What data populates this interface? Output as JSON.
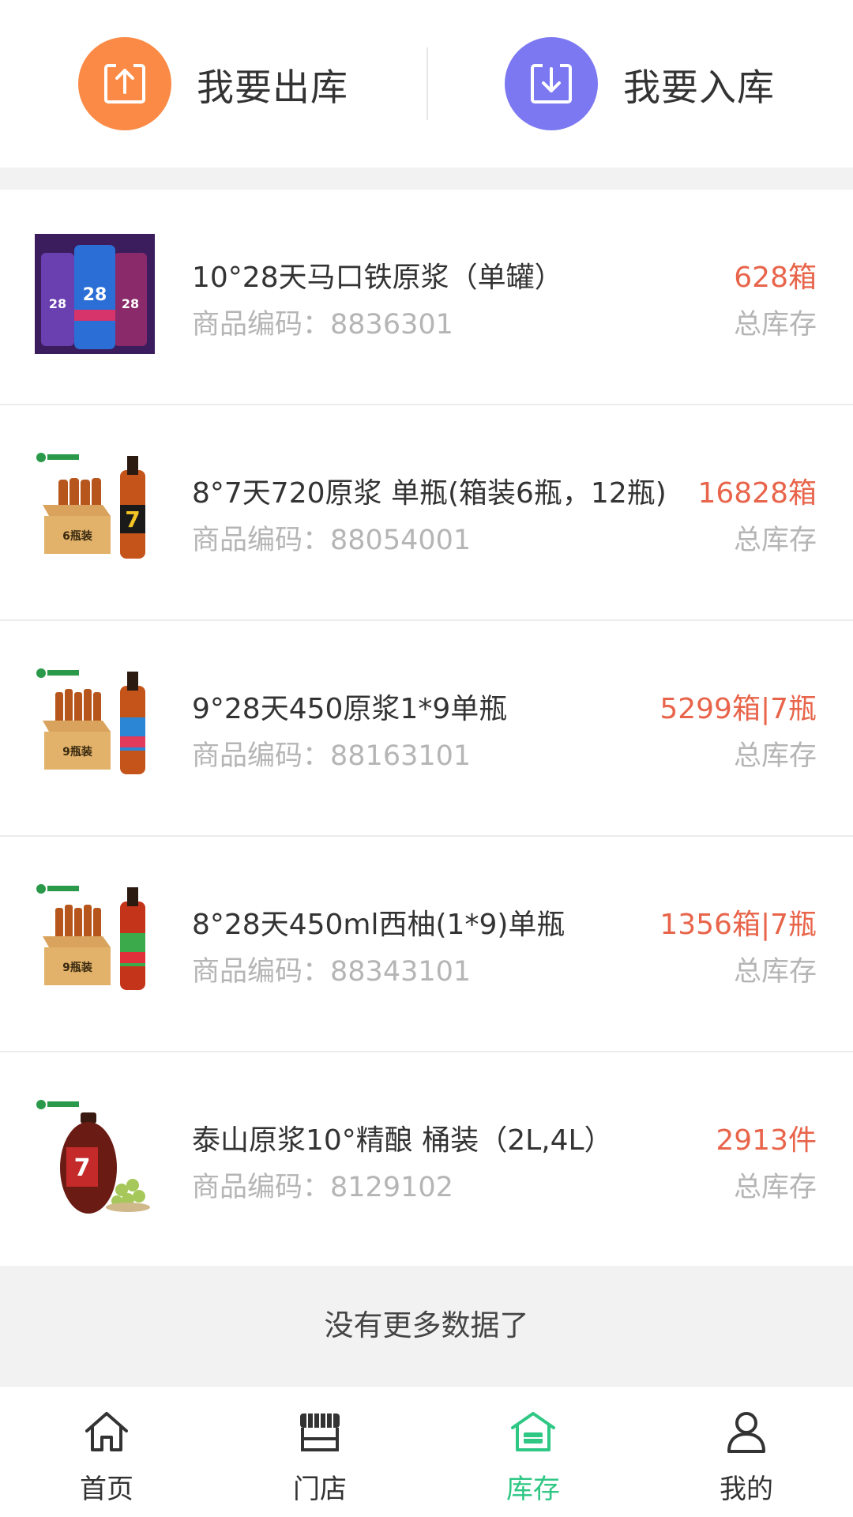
{
  "actions": {
    "outbound": {
      "label": "我要出库",
      "icon": "upload-box-icon",
      "color": "#FA8A45"
    },
    "inbound": {
      "label": "我要入库",
      "icon": "download-box-icon",
      "color": "#7B78F2"
    }
  },
  "products": [
    {
      "name": "10°28天马口铁原浆（单罐）",
      "code_label": "商品编码：",
      "code": "8836301",
      "stock": "628箱",
      "stock_label": "总库存",
      "image": "cans"
    },
    {
      "name": "8°7天720原浆 单瓶(箱装6瓶，12瓶)",
      "code_label": "商品编码：",
      "code": "88054001",
      "stock": "16828箱",
      "stock_label": "总库存",
      "image": "bottle-box-6"
    },
    {
      "name": "9°28天450原浆1*9单瓶",
      "code_label": "商品编码：",
      "code": "88163101",
      "stock": "5299箱|7瓶",
      "stock_label": "总库存",
      "image": "bottle-box-9-blue"
    },
    {
      "name": "8°28天450ml西柚(1*9)单瓶",
      "code_label": "商品编码：",
      "code": "88343101",
      "stock": "1356箱|7瓶",
      "stock_label": "总库存",
      "image": "bottle-box-9-green"
    },
    {
      "name": "泰山原浆10°精酿 桶装（2L,4L）",
      "code_label": "商品编码：",
      "code": "8129102",
      "stock": "2913件",
      "stock_label": "总库存",
      "image": "keg"
    }
  ],
  "box_labels": {
    "six": "6瓶装",
    "nine": "9瓶装",
    "can_badge": "28"
  },
  "footer": {
    "no_more": "没有更多数据了"
  },
  "tabs": [
    {
      "label": "首页",
      "icon": "home-icon",
      "active": false
    },
    {
      "label": "门店",
      "icon": "store-icon",
      "active": false
    },
    {
      "label": "库存",
      "icon": "inventory-icon",
      "active": true
    },
    {
      "label": "我的",
      "icon": "user-icon",
      "active": false
    }
  ],
  "colors": {
    "accent": "#2EC784",
    "stock": "#E8644A",
    "muted": "#B5B5B5"
  }
}
